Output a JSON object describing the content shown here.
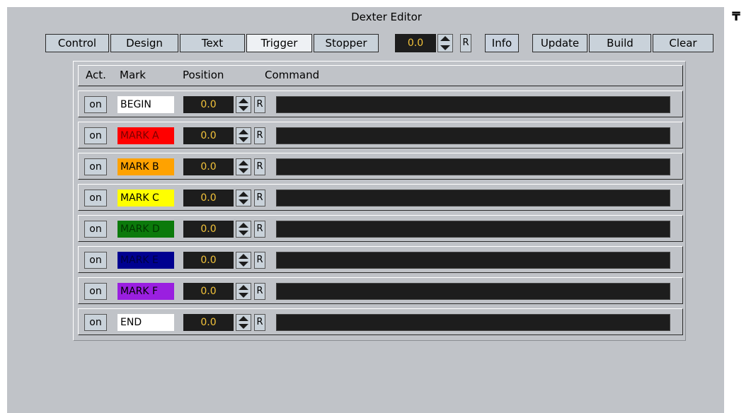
{
  "window": {
    "title": "Dexter Editor",
    "pin_glyph": "₸"
  },
  "toolbar": {
    "tabs": [
      {
        "label": "Control",
        "active": false
      },
      {
        "label": "Design",
        "active": false
      },
      {
        "label": "Text",
        "active": false
      },
      {
        "label": "Trigger",
        "active": true
      },
      {
        "label": "Stopper",
        "active": false
      }
    ],
    "value": "0.0",
    "reset_label": "R",
    "info_label": "Info",
    "actions": [
      "Update",
      "Build",
      "Clear"
    ]
  },
  "table": {
    "headers": {
      "act": "Act.",
      "mark": "Mark",
      "position": "Position",
      "command": "Command"
    },
    "rows": [
      {
        "act": "on",
        "mark": "BEGIN",
        "mark_bg": "#ffffff",
        "mark_fg": "#000000",
        "position": "0.0",
        "reset": "R",
        "command": ""
      },
      {
        "act": "on",
        "mark": "MARK A",
        "mark_bg": "#ff0000",
        "mark_fg": "#7a0000",
        "position": "0.0",
        "reset": "R",
        "command": ""
      },
      {
        "act": "on",
        "mark": "MARK B",
        "mark_bg": "#ffa200",
        "mark_fg": "#000000",
        "position": "0.0",
        "reset": "R",
        "command": ""
      },
      {
        "act": "on",
        "mark": "MARK C",
        "mark_bg": "#ffff00",
        "mark_fg": "#000000",
        "position": "0.0",
        "reset": "R",
        "command": ""
      },
      {
        "act": "on",
        "mark": "MARK D",
        "mark_bg": "#0b7a0b",
        "mark_fg": "#003500",
        "position": "0.0",
        "reset": "R",
        "command": ""
      },
      {
        "act": "on",
        "mark": "MARK E",
        "mark_bg": "#000090",
        "mark_fg": "#000040",
        "position": "0.0",
        "reset": "R",
        "command": ""
      },
      {
        "act": "on",
        "mark": "MARK F",
        "mark_bg": "#9a1fe0",
        "mark_fg": "#000000",
        "position": "0.0",
        "reset": "R",
        "command": ""
      },
      {
        "act": "on",
        "mark": "END",
        "mark_bg": "#ffffff",
        "mark_fg": "#000000",
        "position": "0.0",
        "reset": "R",
        "command": ""
      }
    ]
  }
}
